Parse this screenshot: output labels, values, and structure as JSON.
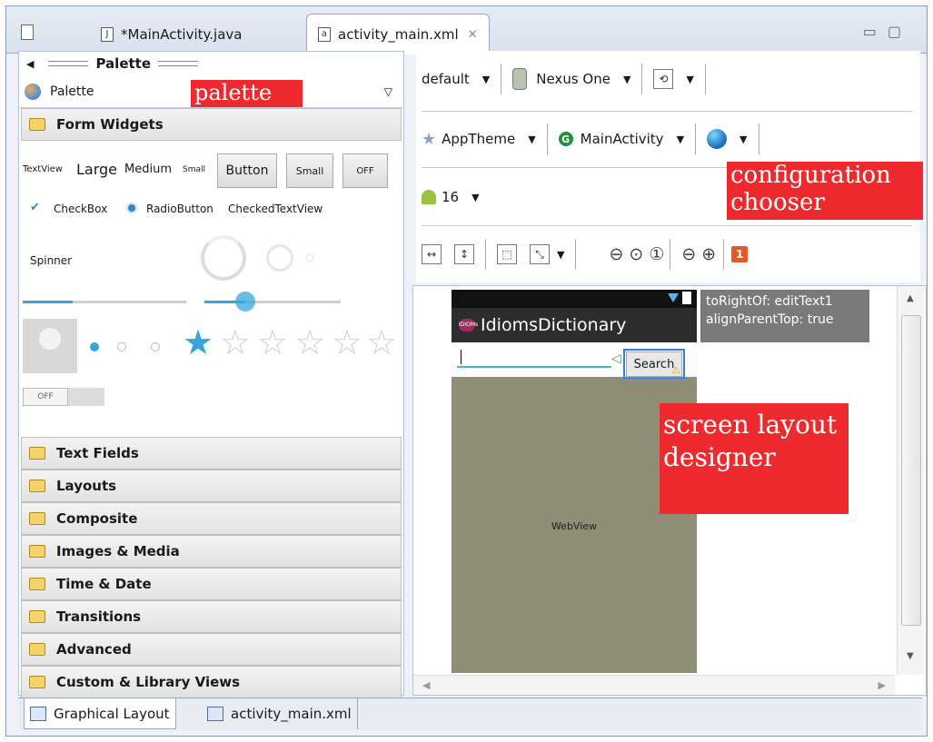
{
  "editor_tabs": [
    {
      "label": "*MainActivity.java",
      "icon": "java-file-icon"
    },
    {
      "label": "activity_main.xml",
      "icon": "xml-file-icon"
    }
  ],
  "palette": {
    "header": "Palette",
    "selector_label": "Palette",
    "form_widgets": "Form Widgets",
    "widgets": {
      "textview": "TextView",
      "large": "Large",
      "medium": "Medium",
      "small_text": "Small",
      "button": "Button",
      "small_button": "Small",
      "toggle": "OFF",
      "checkbox": "CheckBox",
      "radiobutton": "RadioButton",
      "checkedtextview": "CheckedTextView",
      "spinner": "Spinner",
      "switch": "OFF"
    },
    "categories": [
      "Text Fields",
      "Layouts",
      "Composite",
      "Images & Media",
      "Time & Date",
      "Transitions",
      "Advanced",
      "Custom & Library Views"
    ]
  },
  "annotations": {
    "palette": "palette",
    "configuration_chooser": "configuration chooser",
    "screen_layout_designer": "screen layout designer"
  },
  "config": {
    "device_config": "default",
    "device": "Nexus One",
    "theme": "AppTheme",
    "activity": "MainActivity",
    "api_level": "16",
    "error_count": "1"
  },
  "canvas": {
    "app_title": "IdiomsDictionary",
    "app_icon_text": "IDIOMs",
    "search_button": "Search",
    "webview_label": "WebView",
    "tooltip_line1": "toRightOf: editText1",
    "tooltip_line2": "alignParentTop: true"
  },
  "bottom_tabs": [
    "Graphical Layout",
    "activity_main.xml"
  ],
  "colors": {
    "annotation_red": "#ee2a2f",
    "selection_blue": "#2f7fe6",
    "webview_bg": "#8e8e76"
  }
}
